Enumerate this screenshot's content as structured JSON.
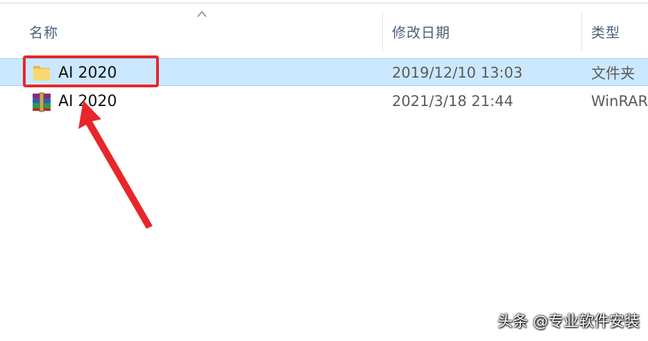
{
  "table": {
    "columns": [
      {
        "label": "名称"
      },
      {
        "label": "修改日期"
      },
      {
        "label": "类型"
      }
    ],
    "sort_column": "名称",
    "rows": [
      {
        "name": "AI 2020",
        "date": "2019/12/10 13:03",
        "type": "文件夹",
        "icon": "folder-icon",
        "selected": true
      },
      {
        "name": "AI 2020",
        "date": "2021/3/18 21:44",
        "type": "WinRAR",
        "icon": "winrar-archive-icon",
        "selected": false
      }
    ]
  },
  "annotation": {
    "highlight_color": "#e8262a",
    "arrow_color": "#e8262a"
  },
  "watermark": {
    "text": "头条 @专业软件安装"
  }
}
